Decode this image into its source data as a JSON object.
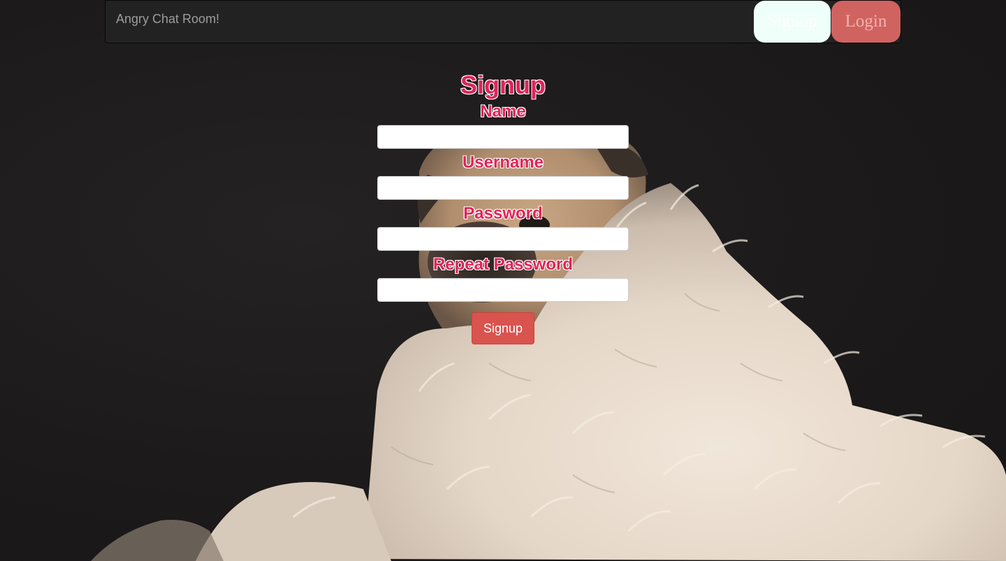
{
  "navbar": {
    "brand": "Angry Chat Room!",
    "signup_label": "Signup",
    "login_label": "Login"
  },
  "form": {
    "title": "Signup",
    "fields": [
      {
        "label": "Name",
        "value": "",
        "placeholder": ""
      },
      {
        "label": "Username",
        "value": "",
        "placeholder": ""
      },
      {
        "label": "Password",
        "value": "",
        "placeholder": ""
      },
      {
        "label": "Repeat Password",
        "value": "",
        "placeholder": ""
      }
    ],
    "submit_label": "Signup"
  },
  "background": {
    "subject": "pug-in-blanket-photo"
  },
  "colors": {
    "label_red": "#e0245a",
    "navbar_bg": "#222222",
    "signup_nav_bg": "#effff9",
    "login_nav_bg": "#d06360",
    "submit_bg": "#d9534f"
  }
}
